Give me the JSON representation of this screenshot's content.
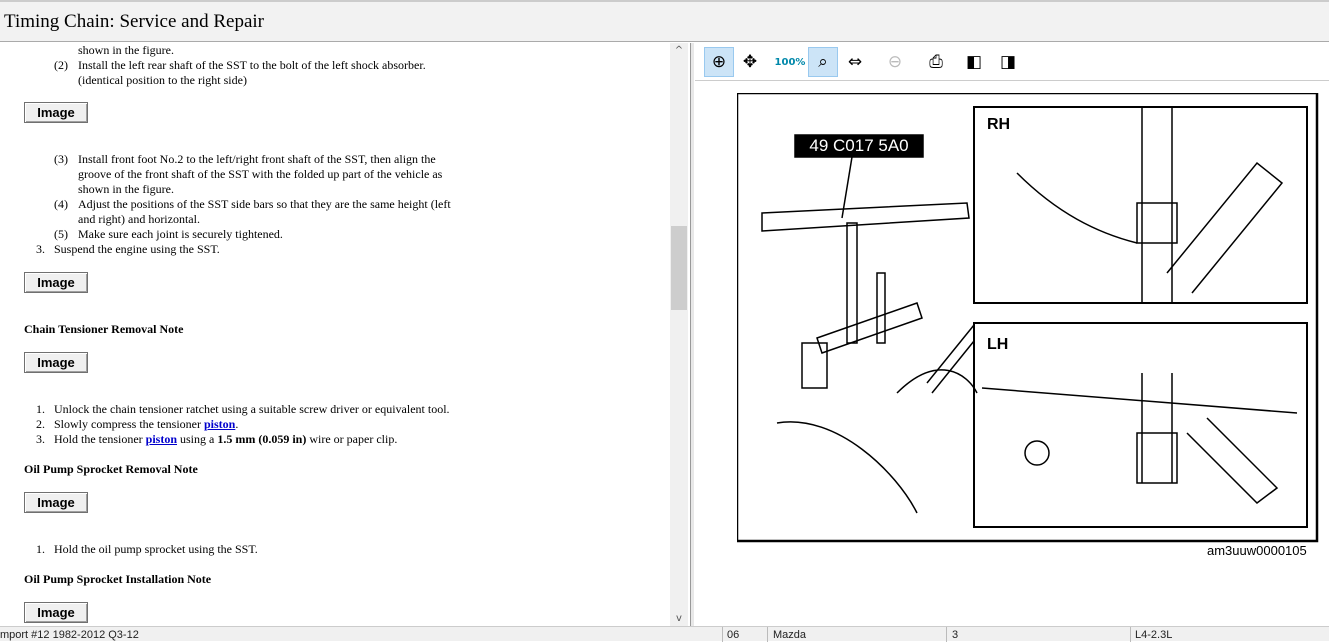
{
  "title": "Timing Chain:  Service and Repair",
  "content": {
    "line0": "shown in the figure.",
    "step2_num": "(2)",
    "step2_a": "Install the left rear shaft of the SST to the bolt of the left shock absorber.",
    "step2_b": "(identical position to the right side)",
    "image_label": "Image",
    "step3_num": "(3)",
    "step3_a": "Install front foot No.2 to the left/right front shaft of the SST, then align the",
    "step3_b": "groove of the front shaft of the SST with the folded up part of the vehicle as",
    "step3_c": "shown in the figure.",
    "step4_num": "(4)",
    "step4_a": "Adjust the positions of the SST side bars so that they are the same height (left",
    "step4_b": "and right) and horizontal.",
    "step5_num": "(5)",
    "step5_a": "Make sure each joint is securely tightened.",
    "s3_num": "3.",
    "s3": "Suspend the engine using the SST.",
    "h1": "Chain Tensioner Removal Note",
    "t1_num": "1.",
    "t1": "Unlock the chain tensioner ratchet using a suitable screw driver or equivalent tool.",
    "t2_num": "2.",
    "t2_pre": "Slowly compress the tensioner ",
    "t2_link": "piston",
    "t2_post": ".",
    "t3_num": "3.",
    "t3_pre": "Hold the tensioner ",
    "t3_link": "piston",
    "t3_mid": " using a ",
    "t3_bold": "1.5 mm (0.059 in)",
    "t3_post": " wire or paper clip.",
    "h2": "Oil Pump Sprocket Removal Note",
    "o1_num": "1.",
    "o1": "Hold the oil pump sprocket using the SST.",
    "h3": "Oil Pump Sprocket Installation Note"
  },
  "figure": {
    "tool_label": "49 C017 5A0",
    "rh": "RH",
    "lh": "LH",
    "caption": "am3uuw0000105"
  },
  "status": {
    "c1": "mport #12 1982-2012 Q3-12",
    "c2": "06",
    "c3": "Mazda",
    "c4": "3",
    "c5": "L4-2.3L"
  },
  "toolbar": {
    "zoom_100": "100%"
  }
}
